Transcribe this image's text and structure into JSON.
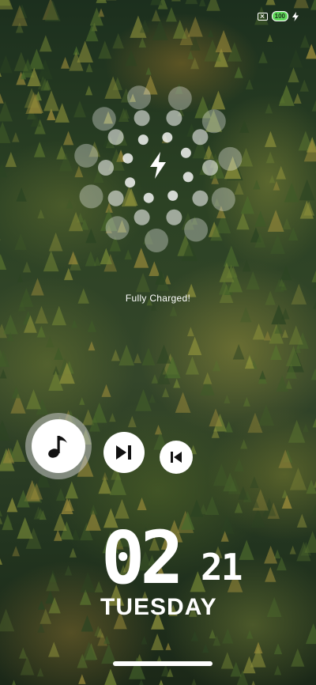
{
  "status_bar": {
    "sim_icon": "no-sim-icon",
    "battery_level": "100",
    "battery_color": "#5fd85a",
    "charging_icon": "bolt-icon"
  },
  "charging": {
    "icon": "bolt-icon",
    "message": "Fully Charged!"
  },
  "music_controls": {
    "music_icon": "music-note-icon",
    "next_icon": "skip-next-icon",
    "previous_icon": "skip-previous-icon"
  },
  "clock": {
    "hours": "02",
    "minutes": "21",
    "day": "TUESDAY"
  }
}
